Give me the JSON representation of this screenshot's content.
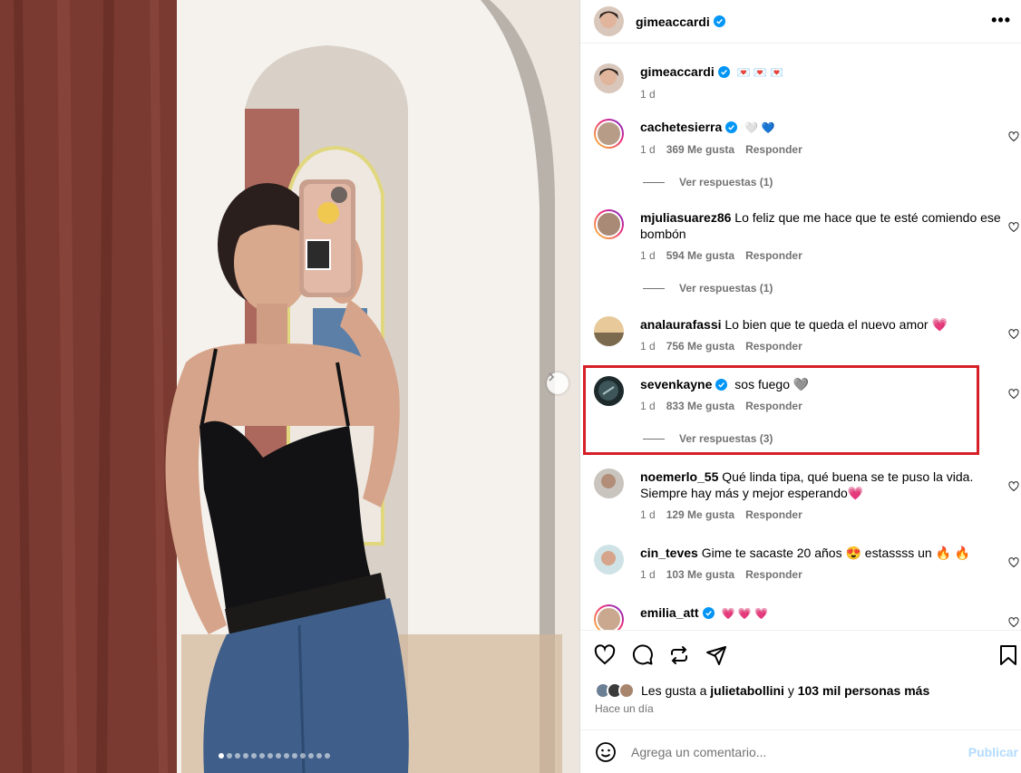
{
  "header": {
    "username": "gimeaccardi"
  },
  "caption": {
    "username": "gimeaccardi",
    "text": "💌 💌 💌",
    "time": "1 d"
  },
  "comments": [
    {
      "username": "cachetesierra",
      "verified": true,
      "text": "🤍 💙",
      "time": "1 d",
      "likes": "369 Me gusta",
      "reply": "Responder",
      "replies": "Ver respuestas (1)"
    },
    {
      "username": "mjuliasuarez86",
      "verified": false,
      "text": "Lo feliz que me hace que te esté comiendo ese bombón",
      "time": "1 d",
      "likes": "594 Me gusta",
      "reply": "Responder",
      "replies": "Ver respuestas (1)"
    },
    {
      "username": "analaurafassi",
      "verified": false,
      "text": "Lo bien que te queda el nuevo amor 💗",
      "time": "1 d",
      "likes": "756 Me gusta",
      "reply": "Responder",
      "replies": ""
    },
    {
      "username": "sevenkayne",
      "verified": true,
      "text": "sos fuego 🩶",
      "time": "1 d",
      "likes": "833 Me gusta",
      "reply": "Responder",
      "replies": "Ver respuestas (3)"
    },
    {
      "username": "noemerlo_55",
      "verified": false,
      "text": "Qué linda tipa, qué buena se te puso la vida. Siempre hay más y mejor esperando💗",
      "time": "1 d",
      "likes": "129 Me gusta",
      "reply": "Responder",
      "replies": ""
    },
    {
      "username": "cin_teves",
      "verified": false,
      "text": "Gime te sacaste 20 años 😍 estassss un 🔥 🔥",
      "time": "1 d",
      "likes": "103 Me gusta",
      "reply": "Responder",
      "replies": ""
    },
    {
      "username": "emilia_att",
      "verified": true,
      "text": "💗 💗 💗",
      "time": "",
      "likes": "",
      "reply": "",
      "replies": ""
    }
  ],
  "footer": {
    "likes_prefix": "Les gusta a ",
    "likes_user": "julietabollini",
    "likes_mid": " y ",
    "likes_count": "103 mil personas más",
    "when": "Hace un día",
    "comment_placeholder": "Agrega un comentario...",
    "post_label": "Publicar"
  },
  "carousel": {
    "count": 14,
    "active_index": 0
  },
  "colors": {
    "highlight": "#d61f26",
    "verified": "#0095f6",
    "post": "#b3dbff"
  }
}
